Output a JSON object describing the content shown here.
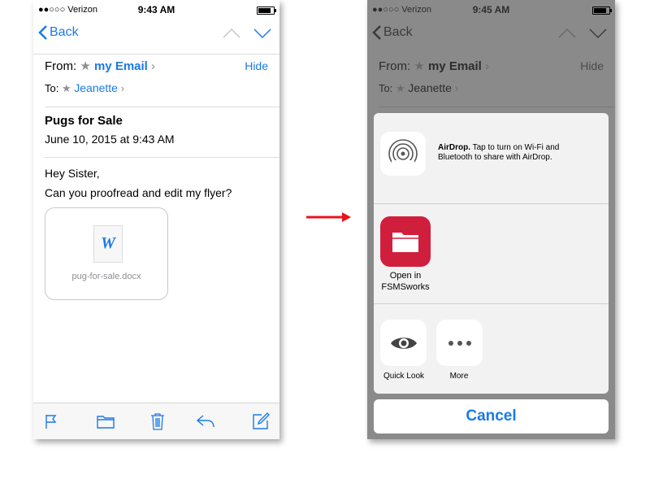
{
  "left_phone": {
    "status": {
      "carrier": "●●○○○ Verizon",
      "time": "9:43 AM"
    },
    "nav": {
      "back_label": "Back"
    },
    "header": {
      "from_label": "From:",
      "from_value": "my Email",
      "hide_label": "Hide",
      "to_label": "To:",
      "to_value": "Jeanette"
    },
    "message": {
      "subject": "Pugs for Sale",
      "date": "June 10, 2015 at 9:43 AM",
      "body_line1": "Hey Sister,",
      "body_line2": "Can you proofread and edit my flyer?"
    },
    "attachment": {
      "icon_letter": "W",
      "filename": "pug-for-sale.docx"
    },
    "toolbar_icons": [
      "flag-icon",
      "folder-icon",
      "trash-icon",
      "reply-icon",
      "compose-icon"
    ]
  },
  "right_phone": {
    "status": {
      "carrier": "●●○○○ Verizon",
      "time": "9:45 AM"
    },
    "nav": {
      "back_label": "Back"
    },
    "header": {
      "from_label": "From:",
      "from_value": "my Email",
      "hide_label": "Hide",
      "to_label": "To:",
      "to_value": "Jeanette"
    },
    "share_sheet": {
      "airdrop_title": "AirDrop.",
      "airdrop_text": "Tap to turn on Wi-Fi and Bluetooth to share with AirDrop.",
      "app_label_line1": "Open in",
      "app_label_line2": "FSMSworks",
      "actions": [
        "Quick Look",
        "More"
      ],
      "cancel_label": "Cancel"
    }
  },
  "colors": {
    "accent": "#1a7ae8",
    "arrow": "#e8141d",
    "app_icon": "#d01f3c"
  }
}
